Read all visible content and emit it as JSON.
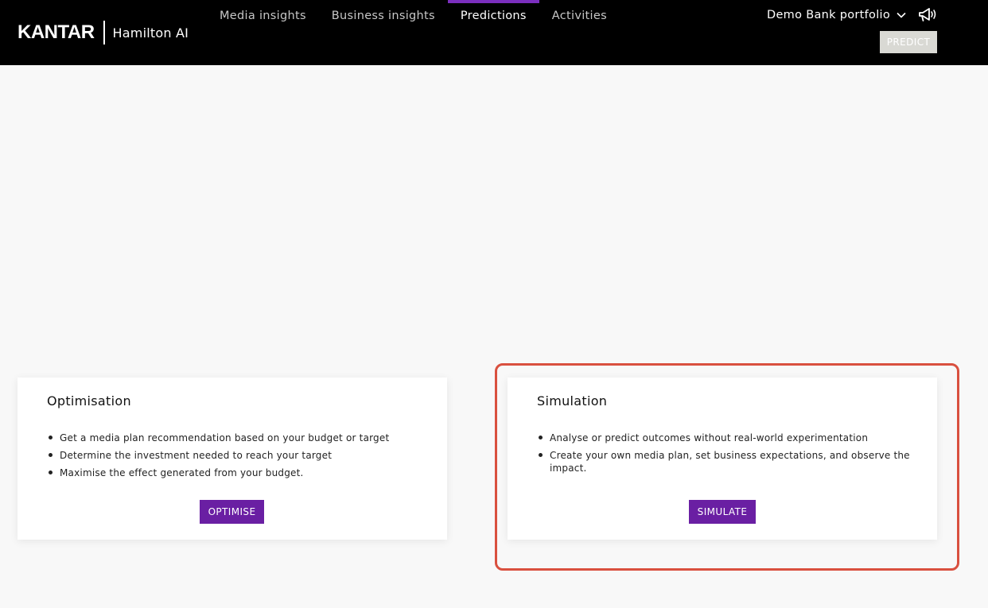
{
  "header": {
    "brand": "KANTAR",
    "product": "Hamilton AI",
    "nav": [
      {
        "label": "Media insights",
        "active": false
      },
      {
        "label": "Business insights",
        "active": false
      },
      {
        "label": "Predictions",
        "active": true
      },
      {
        "label": "Activities",
        "active": false
      }
    ],
    "portfolio_label": "Demo Bank portfolio",
    "predict_label": "PREDICT",
    "icons": {
      "portfolio_dropdown": "chevron-down-icon",
      "announcements": "megaphone-icon"
    }
  },
  "cards": {
    "optimisation": {
      "title": "Optimisation",
      "bullets": [
        "Get a media plan recommendation based on your budget or target",
        "Determine the investment needed to reach your target",
        "Maximise the effect generated from your budget."
      ],
      "button_label": "OPTIMISE"
    },
    "simulation": {
      "title": "Simulation",
      "bullets": [
        "Analyse or predict outcomes without real-world experimentation",
        "Create your own media plan, set business expectations, and observe the impact."
      ],
      "button_label": "SIMULATE",
      "highlighted": true
    }
  },
  "colors": {
    "header_bg": "#000000",
    "accent_purple": "#6a1fa3",
    "active_tab_indicator": "#7b2fbe",
    "highlight_border": "#d9503f",
    "predict_button_bg": "#d9d9d4",
    "page_bg": "#f8f8f8"
  }
}
